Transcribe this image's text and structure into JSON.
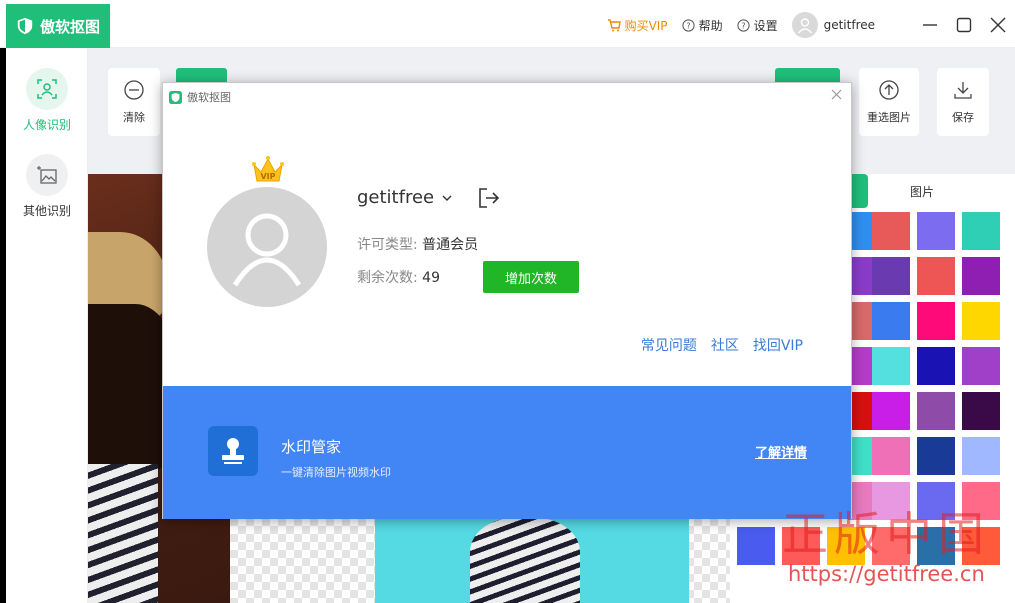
{
  "app": {
    "name": "傲软抠图",
    "buy_vip": "购买VIP",
    "help": "帮助",
    "settings": "设置",
    "username": "getitfree"
  },
  "sidebar": {
    "items": [
      {
        "label": "人像识别",
        "active": true
      },
      {
        "label": "其他识别",
        "active": false
      }
    ]
  },
  "toolbar": {
    "clear": "清除",
    "reselect": "重选图片",
    "save": "保存"
  },
  "right_panel": {
    "tab_image": "图片",
    "swatches": [
      "#2f8ff0",
      "#e85a5a",
      "#7b6cf0",
      "#2fcfb6",
      "#8a3cc8",
      "#6a3ab0",
      "#ee5555",
      "#8e1fb2",
      "#d86a6a",
      "#3a7bf0",
      "#ff0a78",
      "#ffd700",
      "#b53cc8",
      "#55e0e0",
      "#1a12b2",
      "#a040c8",
      "#d61010",
      "#c81ee8",
      "#8e4ca8",
      "#3a0a48",
      "#40e0c8",
      "#f070b8",
      "#1a3a98",
      "#a0b8ff",
      "#e87ac0",
      "#e898e0",
      "#6a6af0",
      "#ff6a88",
      "#4a5cf0",
      "#ff5a5a",
      "#ffc000",
      "#ff6a6a",
      "#2a70a8",
      "#ff5a3a"
    ]
  },
  "modal": {
    "title": "傲软抠图",
    "username": "getitfree",
    "license_label": "许可类型:",
    "license_value": "普通会员",
    "remain_label": "剩余次数:",
    "remain_value": "49",
    "add_button": "增加次数",
    "links": [
      "常见问题",
      "社区",
      "找回VIP"
    ],
    "crown_text": "VIP",
    "banner": {
      "title": "水印管家",
      "subtitle": "一键清除图片视频水印",
      "more": "了解详情"
    }
  },
  "watermark": {
    "text": "正版中国",
    "url": "https://getitfree.cn"
  },
  "colors": {
    "brand_green": "#1fbf7a",
    "banner_blue": "#4285f4",
    "button_green": "#21b627",
    "link_blue": "#3a7bd5"
  }
}
